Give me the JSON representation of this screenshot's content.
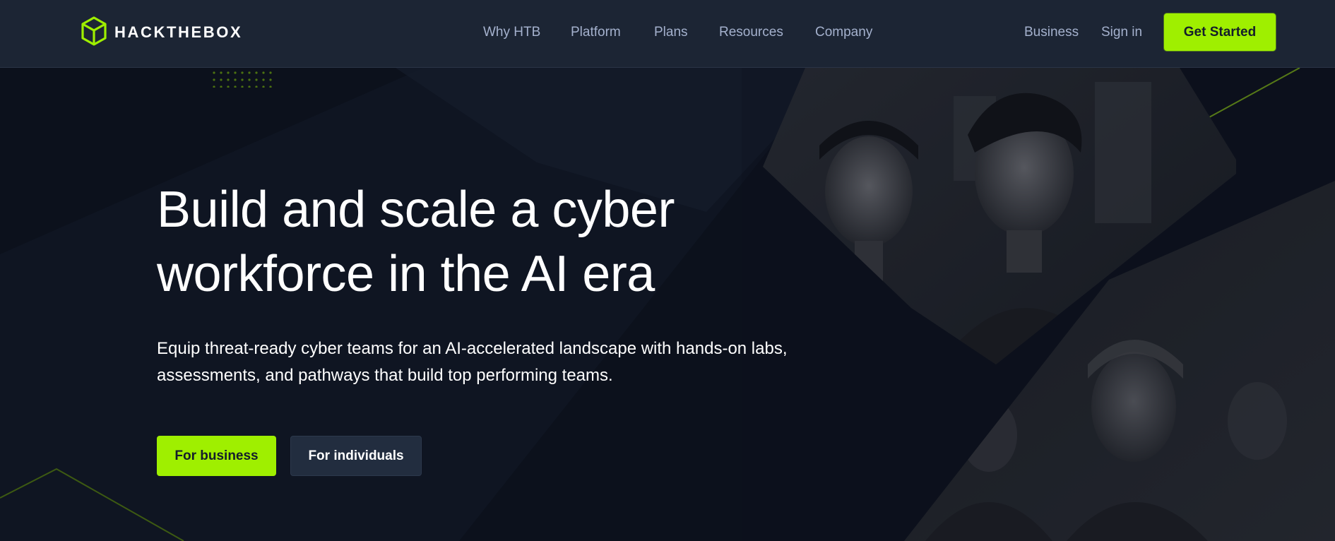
{
  "brand": {
    "name": "HACKTHEBOX",
    "accent": "#9fef00",
    "header_bg": "#1c2534",
    "page_bg": "#0c111c"
  },
  "nav": {
    "items": [
      {
        "label": "Why HTB"
      },
      {
        "label": "Platform"
      },
      {
        "label": "Plans"
      },
      {
        "label": "Resources"
      },
      {
        "label": "Company"
      }
    ],
    "business_label": "Business",
    "signin_label": "Sign in",
    "cta_label": "Get Started"
  },
  "hero": {
    "title_line1": "Build and scale a cyber",
    "title_line2": "workforce in the AI era",
    "subtitle_line1": "Equip threat-ready cyber teams for an AI-accelerated landscape with hands-on labs,",
    "subtitle_line2": "assessments, and pathways that build top performing teams.",
    "primary_button": "For business",
    "secondary_button": "For individuals"
  },
  "icons": {
    "logo": "cube-logo-icon"
  }
}
